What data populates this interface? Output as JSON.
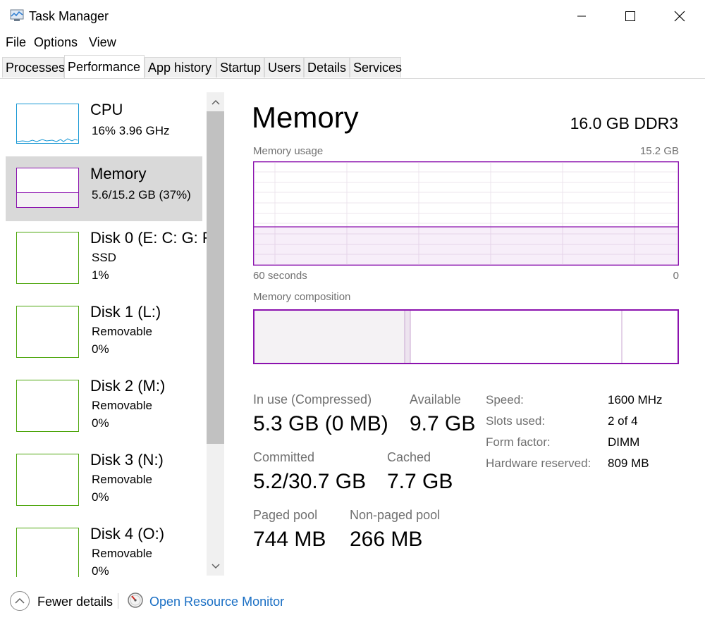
{
  "window": {
    "title": "Task Manager",
    "controls": {
      "minimize": "minimize-icon",
      "maximize": "maximize-icon",
      "close": "close-icon"
    }
  },
  "menu": [
    "File",
    "Options",
    "View"
  ],
  "tabs": [
    "Processes",
    "Performance",
    "App history",
    "Startup",
    "Users",
    "Details",
    "Services"
  ],
  "active_tab": "Performance",
  "sidebar": {
    "items": [
      {
        "name": "CPU",
        "line1": "16%  3.96 GHz",
        "line2": ""
      },
      {
        "name": "Memory",
        "line1": "5.6/15.2 GB (37%)",
        "line2": ""
      },
      {
        "name": "Disk 0 (E: C: G: F",
        "line1": "SSD",
        "line2": "1%"
      },
      {
        "name": "Disk 1 (L:)",
        "line1": "Removable",
        "line2": "0%"
      },
      {
        "name": "Disk 2 (M:)",
        "line1": "Removable",
        "line2": "0%"
      },
      {
        "name": "Disk 3 (N:)",
        "line1": "Removable",
        "line2": "0%"
      },
      {
        "name": "Disk 4 (O:)",
        "line1": "Removable",
        "line2": "0%"
      }
    ],
    "selected_index": 1
  },
  "main": {
    "title": "Memory",
    "hardware": "16.0 GB DDR3",
    "usage_label": "Memory usage",
    "usage_max": "15.2 GB",
    "time_left": "60 seconds",
    "time_right": "0",
    "usage_fraction": 0.37,
    "composition_label": "Memory composition",
    "stats": {
      "in_use_label": "In use (Compressed)",
      "in_use_value": "5.3 GB (0 MB)",
      "available_label": "Available",
      "available_value": "9.7 GB",
      "committed_label": "Committed",
      "committed_value": "5.2/30.7 GB",
      "cached_label": "Cached",
      "cached_value": "7.7 GB",
      "paged_label": "Paged pool",
      "paged_value": "744 MB",
      "nonpaged_label": "Non-paged pool",
      "nonpaged_value": "266 MB"
    },
    "details": [
      {
        "label": "Speed:",
        "value": "1600 MHz"
      },
      {
        "label": "Slots used:",
        "value": "2 of 4"
      },
      {
        "label": "Form factor:",
        "value": "DIMM"
      },
      {
        "label": "Hardware reserved:",
        "value": "809 MB"
      }
    ]
  },
  "footer": {
    "fewer_details": "Fewer details",
    "resource_monitor": "Open Resource Monitor"
  },
  "colors": {
    "memory_accent": "#8b12ae",
    "memory_fill": "#f4f2f4",
    "disk_accent": "#4da60c",
    "cpu_accent": "#1797d4",
    "link": "#1a6fc4"
  }
}
